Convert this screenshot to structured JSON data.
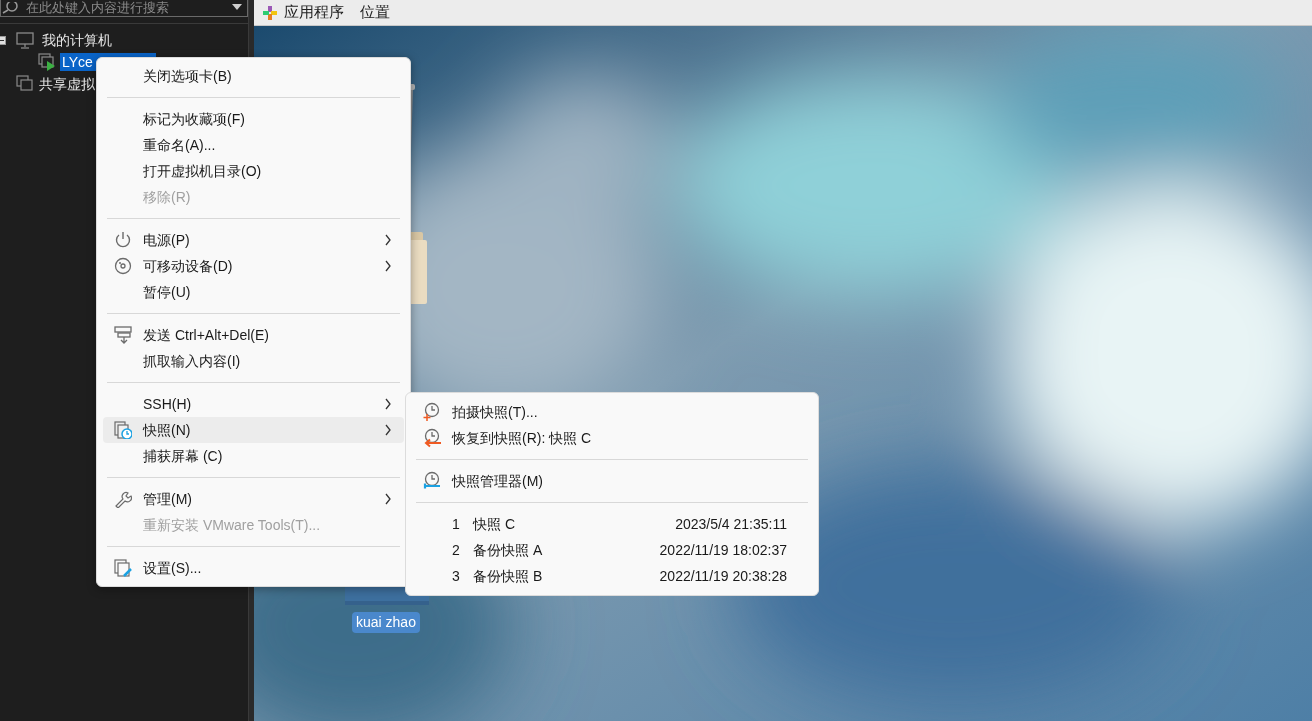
{
  "sidebar": {
    "search": {
      "placeholder": "在此处键入内容进行搜索"
    },
    "tree": [
      {
        "label": "我的计算机",
        "expanded": true,
        "selected": false,
        "children": [
          {
            "label": "LYce",
            "selected": true
          }
        ]
      },
      {
        "label": "共享虚拟",
        "selected": false
      }
    ]
  },
  "top_bar": {
    "menus": [
      "应用程序",
      "位置"
    ]
  },
  "desktop": {
    "icons": [
      {
        "kind": "trash"
      },
      {
        "kind": "folder"
      },
      {
        "kind": "file",
        "label": "kuai zhao",
        "selected": true
      }
    ]
  },
  "context_menu": {
    "items": [
      {
        "kind": "item",
        "label": "关闭选项卡(B)",
        "disabled": false,
        "submenu": false,
        "selected": false
      },
      {
        "kind": "separator"
      },
      {
        "kind": "item",
        "label": "标记为收藏项(F)",
        "disabled": false,
        "submenu": false,
        "selected": false
      },
      {
        "kind": "item",
        "label": "重命名(A)...",
        "disabled": false,
        "submenu": false,
        "selected": false
      },
      {
        "kind": "item",
        "label": "打开虚拟机目录(O)",
        "disabled": false,
        "submenu": false,
        "selected": false
      },
      {
        "kind": "item",
        "label": "移除(R)",
        "disabled": true,
        "submenu": false,
        "selected": false
      },
      {
        "kind": "separator"
      },
      {
        "kind": "item",
        "label": "电源(P)",
        "disabled": false,
        "submenu": true,
        "selected": false
      },
      {
        "kind": "item",
        "label": "可移动设备(D)",
        "disabled": false,
        "submenu": true,
        "selected": false
      },
      {
        "kind": "item",
        "label": "暂停(U)",
        "disabled": false,
        "submenu": false,
        "selected": false
      },
      {
        "kind": "separator"
      },
      {
        "kind": "item",
        "label": "发送 Ctrl+Alt+Del(E)",
        "disabled": false,
        "submenu": false,
        "selected": false
      },
      {
        "kind": "item",
        "label": "抓取输入内容(I)",
        "disabled": false,
        "submenu": false,
        "selected": false
      },
      {
        "kind": "separator"
      },
      {
        "kind": "item",
        "label": "SSH(H)",
        "disabled": false,
        "submenu": true,
        "selected": false
      },
      {
        "kind": "item",
        "label": "快照(N)",
        "disabled": false,
        "submenu": true,
        "selected": true
      },
      {
        "kind": "item",
        "label": "捕获屏幕 (C)",
        "disabled": false,
        "submenu": false,
        "selected": false
      },
      {
        "kind": "separator"
      },
      {
        "kind": "item",
        "label": "管理(M)",
        "disabled": false,
        "submenu": true,
        "selected": false
      },
      {
        "kind": "item",
        "label": "重新安装 VMware Tools(T)...",
        "disabled": true,
        "submenu": false,
        "selected": false
      },
      {
        "kind": "separator"
      },
      {
        "kind": "item",
        "label": "设置(S)...",
        "disabled": false,
        "submenu": false,
        "selected": false
      }
    ]
  },
  "snapshot_menu": {
    "items": [
      {
        "kind": "item",
        "label": "拍摄快照(T)..."
      },
      {
        "kind": "item",
        "label": "恢复到快照(R): 快照 C"
      },
      {
        "kind": "separator"
      },
      {
        "kind": "item",
        "label": "快照管理器(M)"
      },
      {
        "kind": "separator"
      },
      {
        "kind": "snapshot",
        "number": "1",
        "label": "快照 C",
        "date": "2023/5/4 21:35:11"
      },
      {
        "kind": "snapshot",
        "number": "2",
        "label": "备份快照 A",
        "date": "2022/11/19 18:02:37"
      },
      {
        "kind": "snapshot",
        "number": "3",
        "label": "备份快照 B",
        "date": "2022/11/19 20:38:28"
      }
    ]
  }
}
